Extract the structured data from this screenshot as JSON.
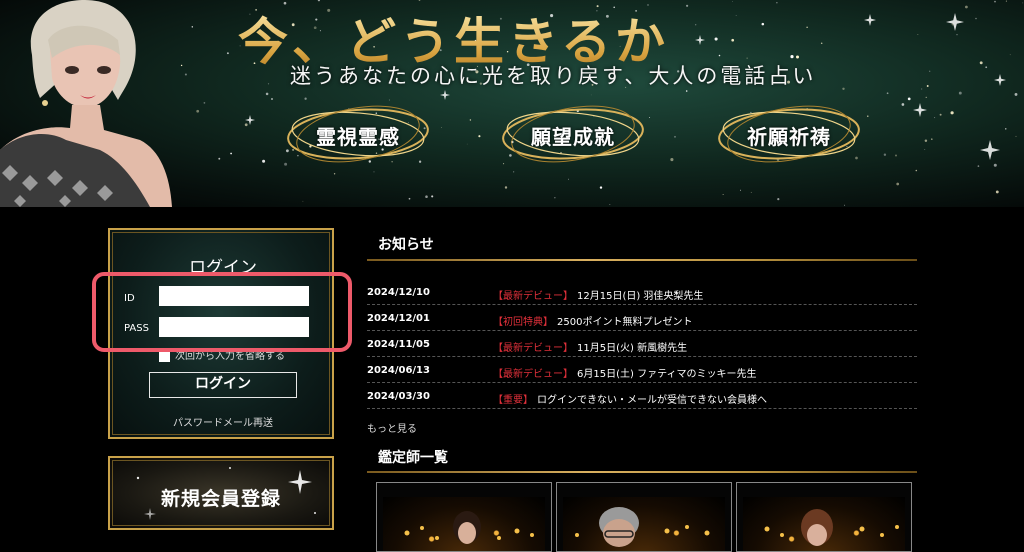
{
  "banner": {
    "title": "今、どう生きるか",
    "subtitle": "迷うあなたの心に光を取り戻す、大人の電話占い",
    "badges": [
      "霊視霊感",
      "願望成就",
      "祈願祈祷"
    ]
  },
  "login": {
    "title": "ログイン",
    "id_label": "ID",
    "id_value": "",
    "pass_label": "PASS",
    "pass_value": "",
    "remember_label": "次回から入力を省略する",
    "button_label": "ログイン",
    "forgot_link": "パスワードメール再送"
  },
  "register": {
    "label": "新規会員登録"
  },
  "news": {
    "title": "お知らせ",
    "items": [
      {
        "date": "2024/12/10",
        "tag": "【最新デビュー】",
        "text": "12月15日(日) 羽佳央梨先生"
      },
      {
        "date": "2024/12/01",
        "tag": "【初回特典】",
        "text": "2500ポイント無料プレゼント"
      },
      {
        "date": "2024/11/05",
        "tag": "【最新デビュー】",
        "text": "11月5日(火) 新風樹先生"
      },
      {
        "date": "2024/06/13",
        "tag": "【最新デビュー】",
        "text": "6月15日(土) ファティマのミッキー先生"
      },
      {
        "date": "2024/03/30",
        "tag": "【重要】",
        "text": "ログインできない・メールが受信できない会員様へ"
      }
    ],
    "more_link": "もっと見る"
  },
  "advisors": {
    "title": "鑑定師一覧"
  },
  "colors": {
    "gold": "#c9a24a",
    "tag_red": "#e0303a",
    "highlight": "#ee5a6a"
  }
}
